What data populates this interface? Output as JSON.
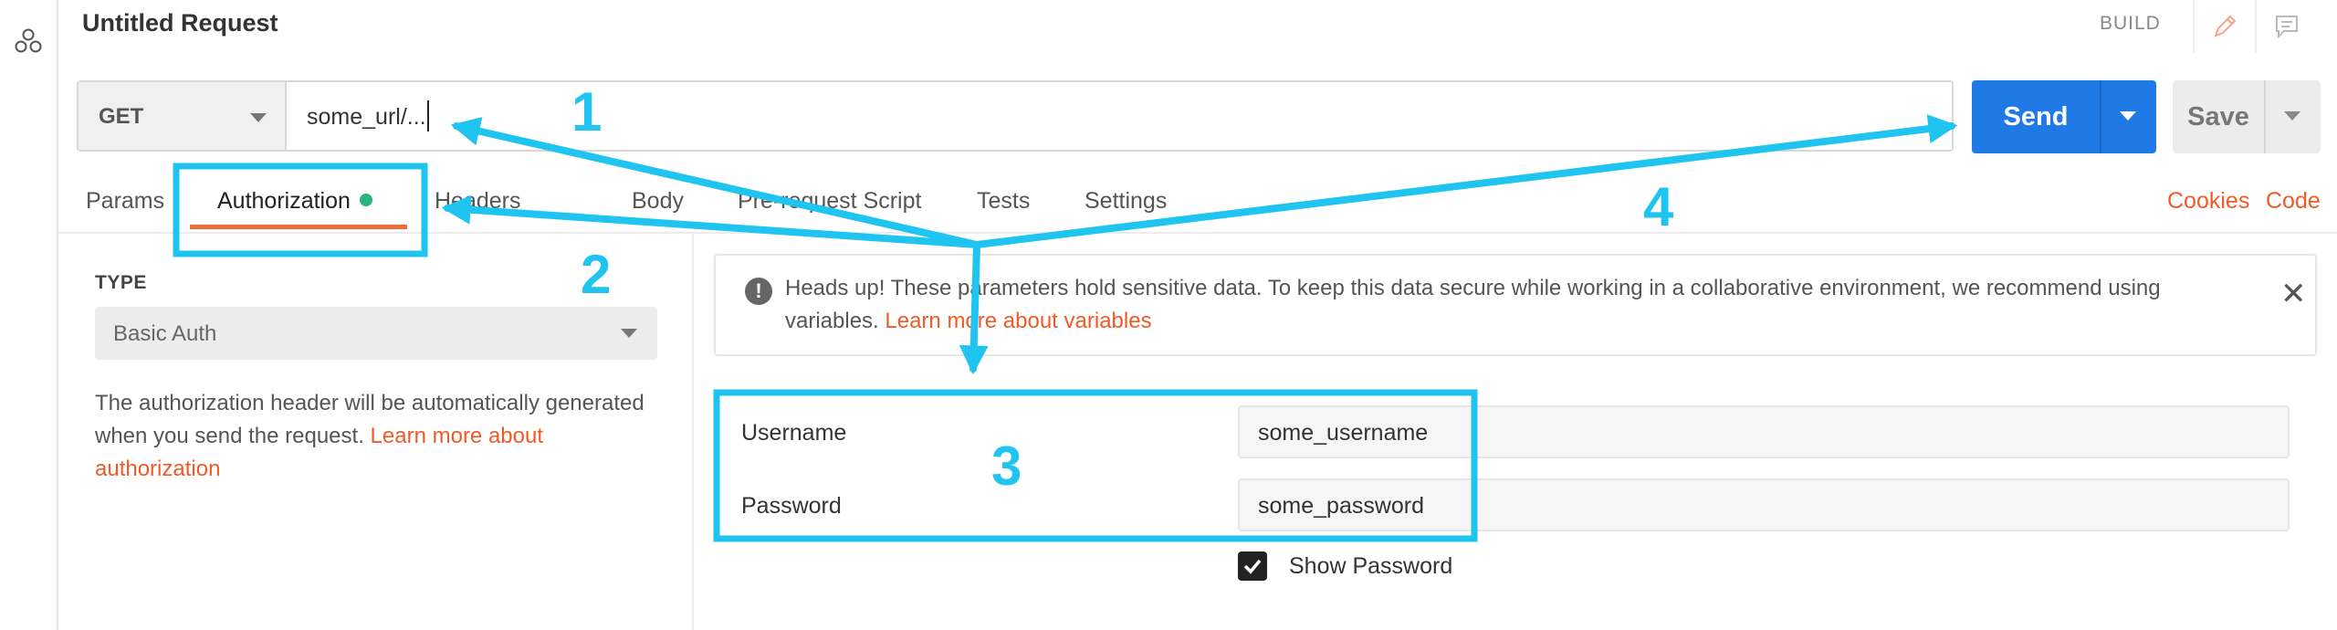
{
  "request": {
    "title": "Untitled Request",
    "mode": "BUILD"
  },
  "url_bar": {
    "method": "GET",
    "url": "some_url/...",
    "send_label": "Send",
    "save_label": "Save"
  },
  "tabs": [
    {
      "label": "Params"
    },
    {
      "label": "Authorization"
    },
    {
      "label": "Headers"
    },
    {
      "label": "Body"
    },
    {
      "label": "Pre-request Script"
    },
    {
      "label": "Tests"
    },
    {
      "label": "Settings"
    }
  ],
  "links": {
    "cookies": "Cookies",
    "code": "Code"
  },
  "auth": {
    "type_label": "TYPE",
    "type_value": "Basic Auth",
    "description": "The authorization header will be automatically generated when you send the request.",
    "learn_more": "Learn more about authorization"
  },
  "alert": {
    "text": "Heads up! These parameters hold sensitive data. To keep this data secure while working in a collaborative environment, we recommend using variables.",
    "link": "Learn more about variables"
  },
  "fields": {
    "username_label": "Username",
    "username_value": "some_username",
    "password_label": "Password",
    "password_value": "some_password",
    "show_password_label": "Show Password"
  },
  "annotations": {
    "n1": "1",
    "n2": "2",
    "n3": "3",
    "n4": "4"
  },
  "colors": {
    "accent_orange": "#f05a28",
    "send_blue": "#1f7ae6",
    "annotation_cyan": "#1fc4f0",
    "active_dot_green": "#26b47f"
  }
}
